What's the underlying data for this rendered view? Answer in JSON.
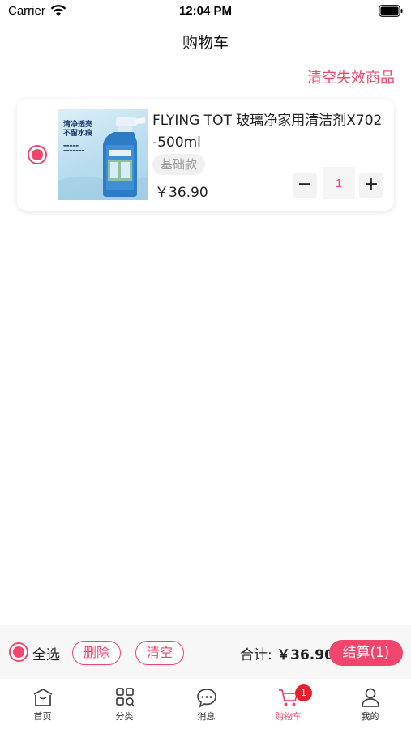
{
  "status_bar": {
    "carrier": "Carrier",
    "time": "12:04 PM",
    "wifi_icon": "wifi-icon",
    "battery_icon": "battery-icon"
  },
  "header": {
    "title": "购物车",
    "clear_invalid_label": "清空失效商品"
  },
  "cart": {
    "items": [
      {
        "selected": true,
        "image_text_line1": "清净透亮",
        "image_text_line2": "不留水痕",
        "title": "FLYING TOT 玻璃净家用清洁剂X702-500ml",
        "spec": "基础款",
        "price": "￥36.90",
        "quantity": "1",
        "minus_label": "−",
        "plus_label": "+"
      }
    ]
  },
  "checkout_bar": {
    "select_all_label": "全选",
    "delete_label": "删除",
    "clear_label": "清空",
    "total_prefix": "合计: ",
    "total_amount": "￥36.90",
    "checkout_label": "结算(1)"
  },
  "tab_bar": {
    "tabs": [
      {
        "label": "首页",
        "icon": "home-icon"
      },
      {
        "label": "分类",
        "icon": "category-icon"
      },
      {
        "label": "消息",
        "icon": "message-icon"
      },
      {
        "label": "购物车",
        "icon": "cart-icon",
        "badge": "1",
        "active": true
      },
      {
        "label": "我的",
        "icon": "user-icon"
      }
    ]
  },
  "colors": {
    "accent": "#f0466d",
    "badge": "#e8202e"
  }
}
